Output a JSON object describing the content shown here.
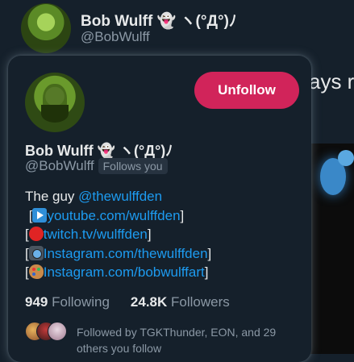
{
  "background": {
    "profile_name": "Bob Wulff 👻 ヽ(°Д°)ﾉ",
    "profile_handle": "@BobWulff",
    "tweet_fragment": "ays r"
  },
  "card": {
    "name": "Bob Wulff 👻 ヽ(°Д°)ﾉ",
    "handle": "@BobWulff",
    "follows_you": "Follows you",
    "unfollow_label": "Unfollow",
    "bio": {
      "line1_text": "The guy ",
      "line1_link": "@thewulffden",
      "youtube": "youtube.com/wulffden",
      "twitch": "twitch.tv/wulffden",
      "instagram1": "Instagram.com/thewulffden",
      "instagram2": "Instagram.com/bobwulffart"
    },
    "stats": {
      "following_count": "949",
      "following_label": "Following",
      "followers_count": "24.8K",
      "followers_label": "Followers"
    },
    "followed_by": "Followed by TGKThunder, EON, and 29 others you follow"
  },
  "colors": {
    "background": "#15202b",
    "accent_link": "#1d9bf0",
    "unfollow_button": "#d1245a"
  },
  "icons": [
    "play-button-emoji",
    "red-circle-emoji",
    "camera-emoji",
    "palette-emoji"
  ]
}
